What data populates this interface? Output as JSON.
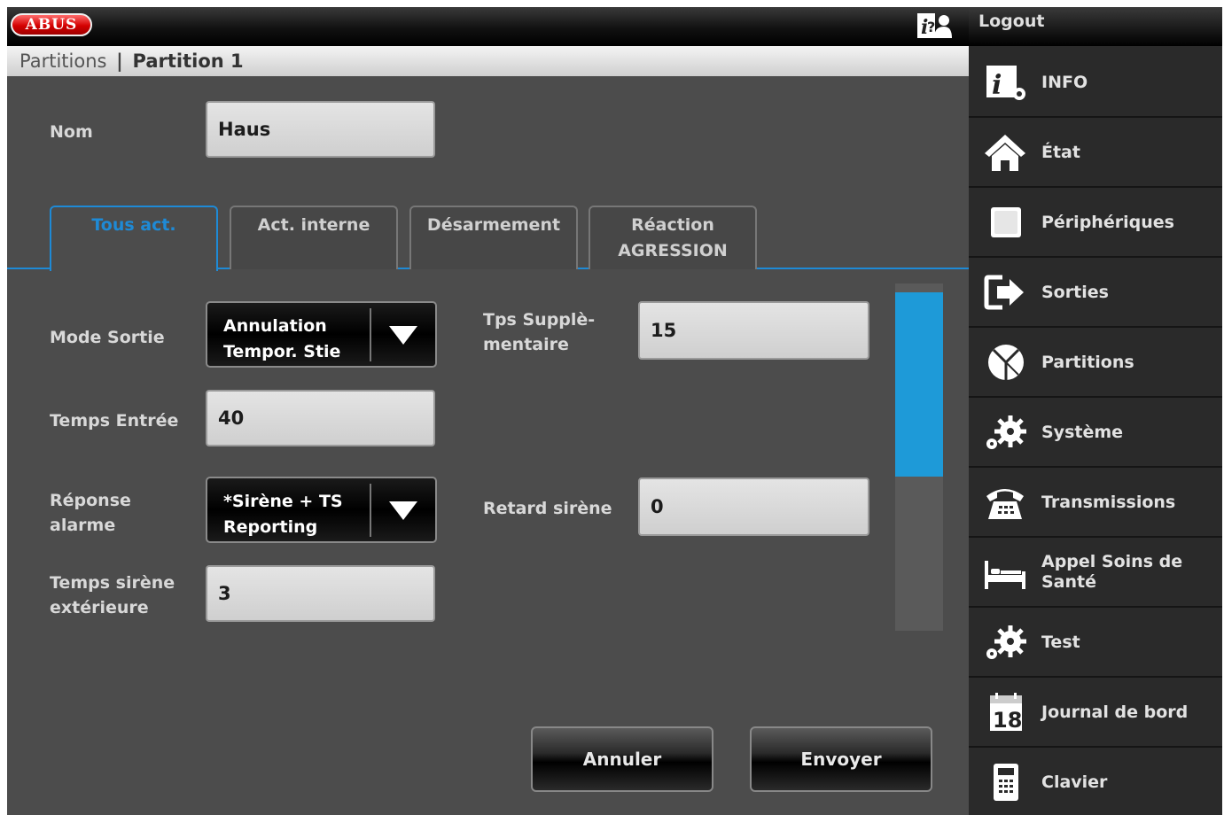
{
  "header": {
    "logo_text": "ABUS",
    "logout_label": "Logout"
  },
  "breadcrumb": {
    "parent": "Partitions",
    "separator": "|",
    "current": "Partition 1"
  },
  "name_field": {
    "label": "Nom",
    "value": "Haus"
  },
  "tabs": [
    {
      "label": "Tous act.",
      "active": true
    },
    {
      "label": "Act. interne",
      "active": false
    },
    {
      "label": "Désarmement",
      "active": false
    },
    {
      "label": "Réaction AGRESSION",
      "active": false
    }
  ],
  "form": {
    "mode_sortie": {
      "label": "Mode Sortie",
      "value_line1": "Annulation",
      "value_line2": "Tempor. Stie"
    },
    "temps_entree": {
      "label": "Temps Entrée",
      "value": "40"
    },
    "reponse_alarme": {
      "label_line1": "Réponse",
      "label_line2": "alarme",
      "value_line1": "*Sirène + TS",
      "value_line2": "Reporting"
    },
    "temps_sirene": {
      "label_line1": "Temps sirène",
      "label_line2": "extérieure",
      "value": "3"
    },
    "tps_supplementaire": {
      "label_line1": "Tps Supplè-",
      "label_line2": "mentaire",
      "value": "15"
    },
    "retard_sirene": {
      "label": "Retard sirène",
      "value": "0"
    }
  },
  "buttons": {
    "cancel": "Annuler",
    "send": "Envoyer"
  },
  "sidebar": {
    "items": [
      {
        "label": "INFO",
        "icon": "info-icon"
      },
      {
        "label": "État",
        "icon": "home-icon"
      },
      {
        "label": "Périphériques",
        "icon": "device-icon"
      },
      {
        "label": "Sorties",
        "icon": "output-icon"
      },
      {
        "label": "Partitions",
        "icon": "partitions-icon"
      },
      {
        "label": "Système",
        "icon": "gears-icon"
      },
      {
        "label": "Transmissions",
        "icon": "telephone-icon"
      },
      {
        "label": "Appel Soins de Santé",
        "icon": "bed-icon"
      },
      {
        "label": "Test",
        "icon": "gears-icon"
      },
      {
        "label": "Journal de bord",
        "icon": "calendar-icon",
        "icon_text": "18"
      },
      {
        "label": "Clavier",
        "icon": "keypad-icon"
      }
    ]
  },
  "colors": {
    "accent": "#1e8ad6",
    "panel": "#4c4c4c",
    "sidebar": "#2a2a2a"
  }
}
